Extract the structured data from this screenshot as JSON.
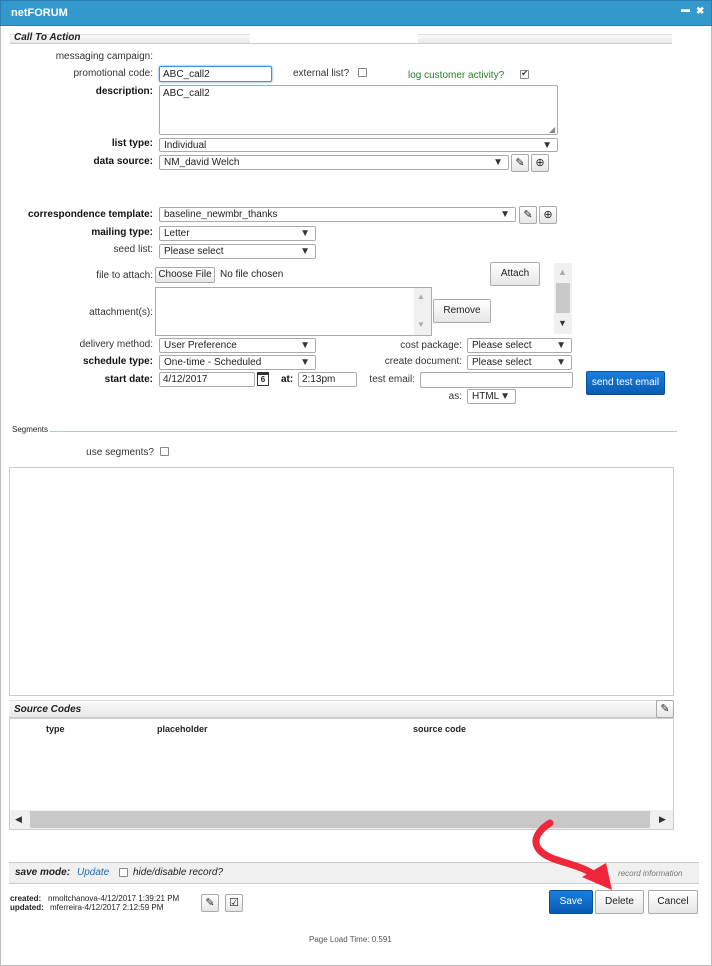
{
  "window": {
    "title": "netFORUM",
    "minimize_glyph": "▬",
    "close_glyph": "✖"
  },
  "call_to_action": {
    "header": "Call To Action",
    "messaging_campaign_label": "messaging campaign:",
    "promotional_code_label": "promotional code:",
    "promotional_code_value": "ABC_call2",
    "external_list_label": "external list?",
    "log_activity_label": "log customer activity?",
    "description_label": "description:",
    "description_value": "ABC_call2",
    "list_type_label": "list type:",
    "list_type_value": "Individual",
    "data_source_label": "data source:",
    "data_source_value": "NM_david Welch",
    "correspondence_template_label": "correspondence template:",
    "correspondence_template_value": "baseline_newmbr_thanks",
    "mailing_type_label": "mailing type:",
    "mailing_type_value": "Letter",
    "seed_list_label": "seed list:",
    "seed_list_value": "Please select",
    "file_to_attach_label": "file to attach:",
    "choose_file_label": "Choose File",
    "no_file_label": "No file chosen",
    "attach_label": "Attach",
    "attachments_label": "attachment(s):",
    "remove_label": "Remove",
    "delivery_method_label": "delivery method:",
    "delivery_method_value": "User Preference",
    "cost_package_label": "cost package:",
    "cost_package_value": "Please select",
    "schedule_type_label": "schedule type:",
    "schedule_type_value": "One-time - Scheduled",
    "create_document_label": "create document:",
    "create_document_value": "Please select",
    "start_date_label": "start date:",
    "start_date_value": "4/12/2017",
    "calendar_glyph": "6",
    "at_label": "at:",
    "time_value": "2:13pm",
    "test_email_label": "test email:",
    "test_email_value": "",
    "send_test_email_label": "send test email",
    "as_label": "as:",
    "format_value": "HTML"
  },
  "segments": {
    "header": "Segments",
    "use_segments_label": "use segments?"
  },
  "source_codes": {
    "header": "Source Codes",
    "columns": [
      "type",
      "placeholder",
      "source code"
    ]
  },
  "footer": {
    "save_mode_label": "save mode:",
    "save_mode_value": "Update",
    "hide_label": "hide/disable record?",
    "record_info_label": "record information",
    "created_label": "created:",
    "created_value": "nmoltchanova-4/12/2017 1:39:21 PM",
    "updated_label": "updated:",
    "updated_value": "mferreira-4/12/2017 2:12:59 PM",
    "save_label": "Save",
    "delete_label": "Delete",
    "cancel_label": "Cancel",
    "page_load_label": "Page Load Time: 0.591"
  },
  "colors": {
    "titlebar": "#3399cc",
    "primary_button": "#0a63c4",
    "annotation_arrow": "#f0273a",
    "link": "#1a6fb0",
    "log_label": "#2a7a2a"
  }
}
